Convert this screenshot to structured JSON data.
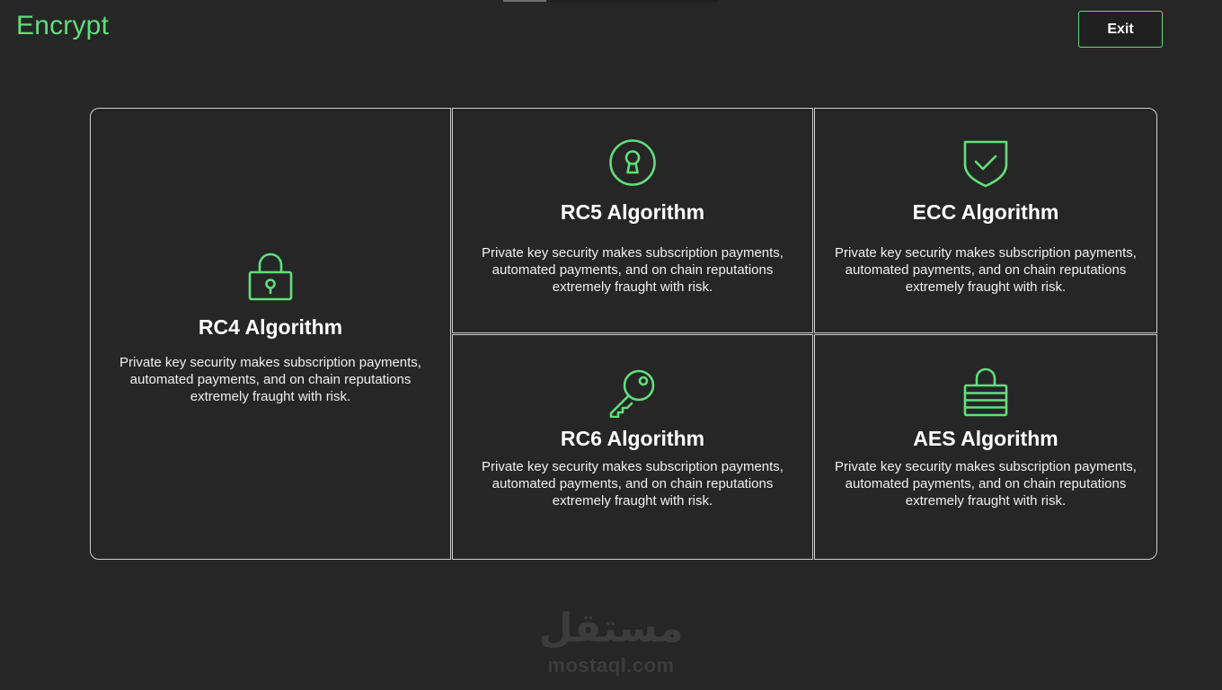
{
  "app": {
    "title": "Encrypt",
    "exit_label": "Exit"
  },
  "colors": {
    "accent": "#5fe07a",
    "background": "#262626",
    "card_border": "#cfcfcf"
  },
  "cards": [
    {
      "id": "rc4",
      "icon": "padlock-icon",
      "title": "RC4 Algorithm",
      "description": "Private key security makes subscription payments, automated payments, and on chain reputations extremely fraught with risk."
    },
    {
      "id": "rc5",
      "icon": "keyhole-icon",
      "title": "RC5 Algorithm",
      "description": "Private key security makes subscription payments, automated payments, and on chain reputations extremely fraught with risk."
    },
    {
      "id": "ecc",
      "icon": "shield-check-icon",
      "title": "ECC Algorithm",
      "description": "Private key security makes subscription payments, automated payments, and on chain reputations extremely fraught with risk."
    },
    {
      "id": "rc6",
      "icon": "key-icon",
      "title": "RC6 Algorithm",
      "description": "Private key security makes subscription payments, automated payments, and on chain reputations extremely fraught with risk."
    },
    {
      "id": "aes",
      "icon": "striped-lock-icon",
      "title": "AES Algorithm",
      "description": "Private key security makes subscription payments, automated payments, and on chain reputations extremely fraught with risk."
    }
  ],
  "watermark": {
    "arabic": "مستقل",
    "latin": "mostaql.com"
  }
}
